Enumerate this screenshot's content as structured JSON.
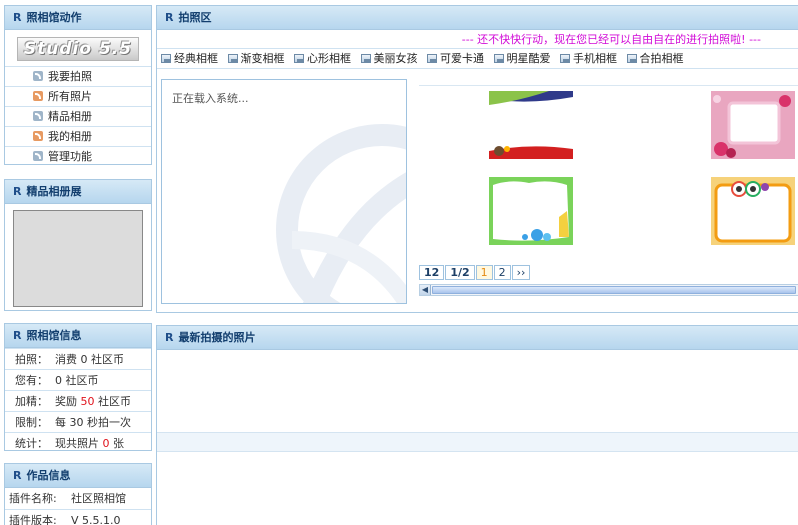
{
  "actions": {
    "title": "照相馆动作",
    "logo": "Studio 5.5",
    "items": [
      {
        "label": "我要拍照",
        "icon": "rss-icon",
        "accent": "#9fb5c9"
      },
      {
        "label": "所有照片",
        "icon": "rss-icon",
        "accent": "#e79a62"
      },
      {
        "label": "精品相册",
        "icon": "rss-icon",
        "accent": "#9fb5c9"
      },
      {
        "label": "我的相册",
        "icon": "rss-icon",
        "accent": "#e79a62"
      },
      {
        "label": "管理功能",
        "icon": "rss-icon",
        "accent": "#9fb5c9"
      }
    ]
  },
  "featured": {
    "title": "精品相册展"
  },
  "info": {
    "title": "照相馆信息",
    "rows": [
      {
        "key": "拍照：",
        "pre": "消费 0 社区币",
        "hl": "",
        "post": ""
      },
      {
        "key": "您有：",
        "pre": "0 社区币",
        "hl": "",
        "post": ""
      },
      {
        "key": "加精：",
        "pre": "奖励 ",
        "hl": "50",
        "post": " 社区币"
      },
      {
        "key": "限制：",
        "pre": "每 30 秒拍一次",
        "hl": "",
        "post": ""
      },
      {
        "key": "统计：",
        "pre": "现共照片 ",
        "hl": "0",
        "post": " 张"
      }
    ]
  },
  "work": {
    "title": "作品信息",
    "rows": [
      {
        "key": "插件名称:",
        "value": "社区照相馆"
      },
      {
        "key": "插件版本:",
        "value": "V 5.5.1.0"
      }
    ]
  },
  "photo": {
    "title": "拍照区",
    "marquee": "--- 还不快快行动，现在您已经可以自由自在的进行拍照啦! ---",
    "tabs": [
      "经典相框",
      "渐变相框",
      "心形相框",
      "美丽女孩",
      "可爱卡通",
      "明星酷爱",
      "手机相框",
      "合拍相框"
    ],
    "loading": "正在载入系统...",
    "pager": [
      "12",
      "1/2",
      "1",
      "2",
      "››"
    ]
  },
  "latest": {
    "title": "最新拍摄的照片"
  },
  "colors": {
    "accent": "#123e6e",
    "highlight": "#e0121b",
    "marquee": "#d10ad7"
  }
}
